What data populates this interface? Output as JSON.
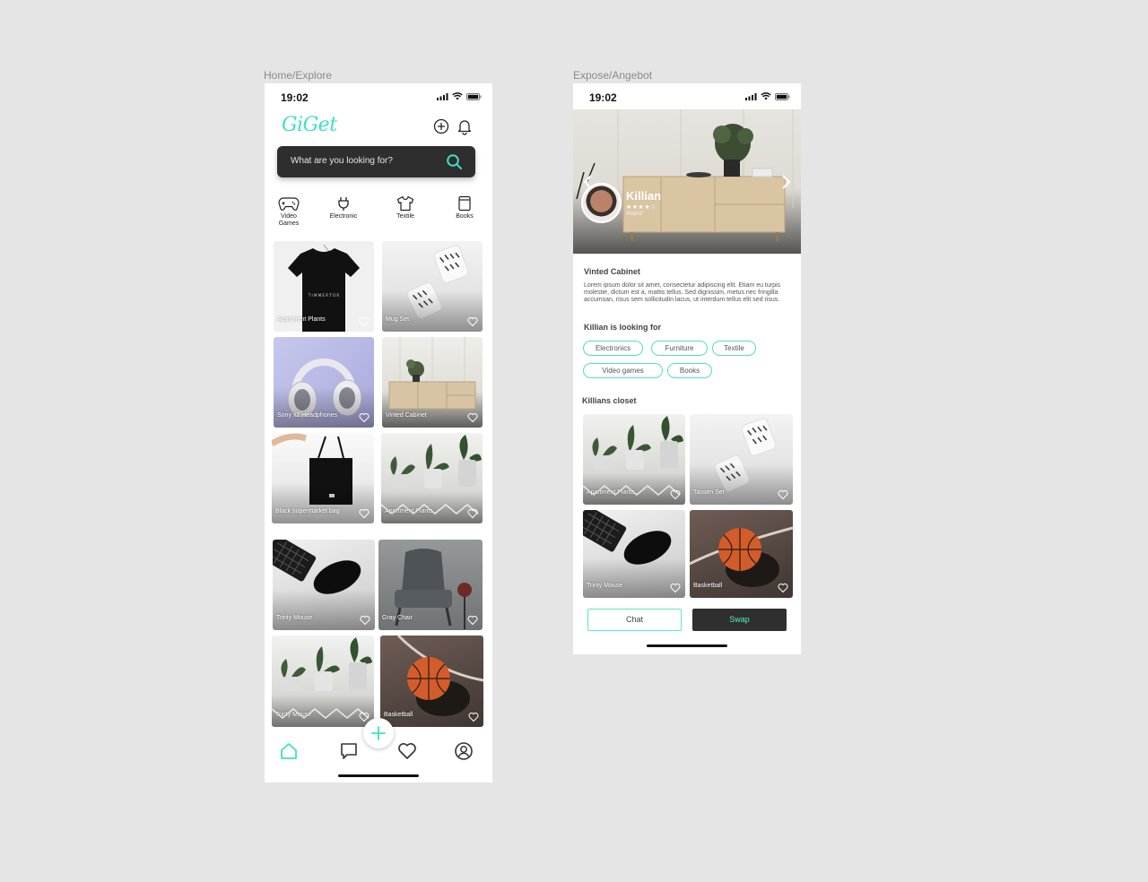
{
  "frames": {
    "home_label": "Home/Explore",
    "detail_label": "Expose/Angebot"
  },
  "status": {
    "time": "19:02"
  },
  "home": {
    "logo": "GiGet",
    "search": {
      "placeholder": "What are you looking for?"
    },
    "categories": [
      {
        "label": "Video\nGames",
        "icon": "gamepad-icon"
      },
      {
        "label": "Electronic",
        "icon": "plug-icon"
      },
      {
        "label": "Textile",
        "icon": "tshirt-icon"
      },
      {
        "label": "Books",
        "icon": "book-icon"
      }
    ],
    "items": [
      "Apartment Plants",
      "Mug Set",
      "Sony x2 Headphones",
      "Vinted Cabinet",
      "Black supermarket bag",
      "Apartment Plants",
      "Trinty Mouse",
      "Gray Chair",
      "Trinty Mouse",
      "Basketball"
    ],
    "nav": [
      "home-icon",
      "chat-icon",
      "heart-icon",
      "profile-icon"
    ],
    "accent": "#3fe0c0"
  },
  "detail": {
    "owner": "Killian",
    "rating_stars": "★★★★☆",
    "rating": 4,
    "city": "Mainz",
    "title": "Vinted Cabinet",
    "description": "Lorem ipsum dolor sit amet, consectetur adipiscing elit. Etiam eu turpis molestie, dictum est a, mattis tellus. Sed dignissim, metus nec fringilla accumsan, risus sem sollicitudin lacus, ut interdum tellus elit sed risus.",
    "looking_for_title": "Killian is looking for",
    "tags": [
      "Electronics",
      "Furniture",
      "Textile",
      "Video games",
      "Books"
    ],
    "closet_title": "Killians closet",
    "closet": [
      "Apartment Plants",
      "Tassen Set",
      "Trinty Mouse",
      "Basketball"
    ],
    "chat_label": "Chat",
    "swap_label": "Swap"
  }
}
